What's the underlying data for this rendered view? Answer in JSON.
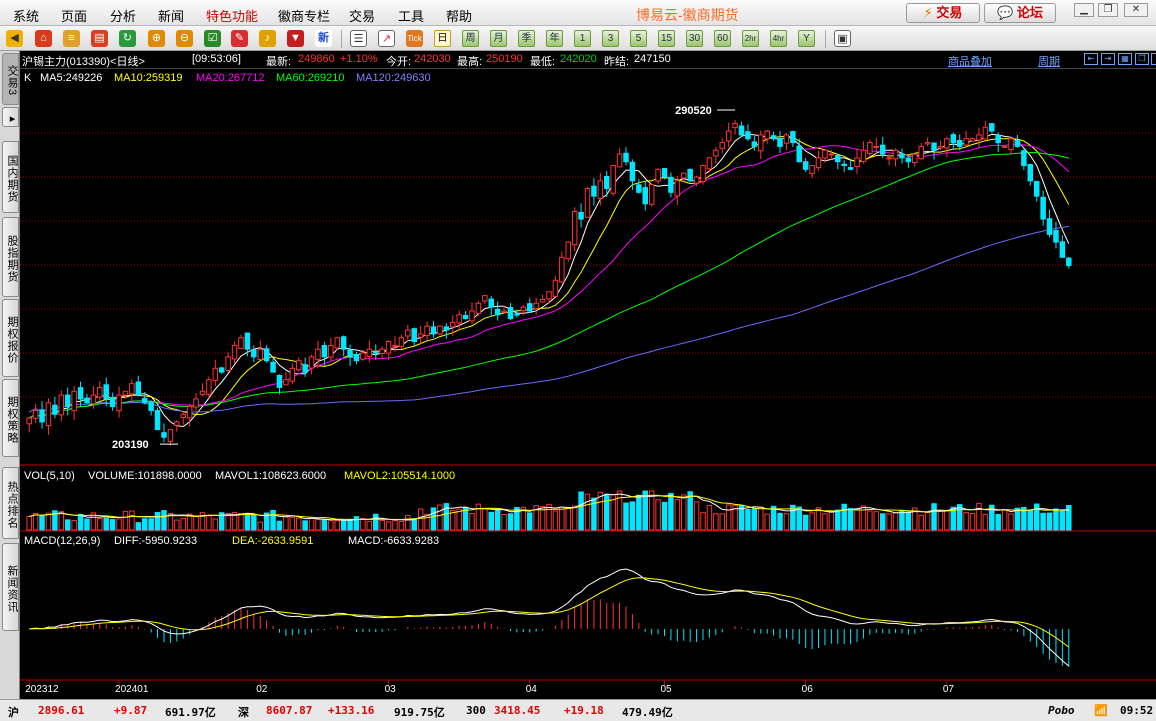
{
  "menu": {
    "items": [
      "系统",
      "页面",
      "分析",
      "新闻",
      "特色功能",
      "徽商专栏",
      "交易",
      "工具",
      "帮助"
    ],
    "special_index": 4,
    "app_title": "博易云-徽商期货",
    "trade_btn": "交易",
    "forum_btn": "论坛"
  },
  "toolbar": {
    "periods": [
      "日",
      "周",
      "月",
      "季",
      "年",
      "1",
      "3",
      "5",
      "15",
      "30",
      "60",
      "2hr",
      "4hr",
      "Y"
    ],
    "active_period": "日",
    "icons": [
      "back-icon",
      "home-icon",
      "database-icon",
      "news-icon",
      "refresh-icon",
      "zoom-in-icon",
      "zoom-out-icon",
      "checkbox-icon",
      "pen-icon",
      "bell-icon",
      "filter-icon",
      "new-icon",
      "list-icon",
      "chart-line-icon",
      "tick-icon"
    ],
    "tick_label": "Tick",
    "new_label": "新"
  },
  "infobar": {
    "contract": "沪锡主力(013390)<日线>",
    "time": "[09:53:06]",
    "latest_label": "最新:",
    "latest": "249860",
    "change": "+1.10%",
    "open_label": "今开:",
    "open": "242030",
    "high_label": "最高:",
    "high": "250190",
    "low_label": "最低:",
    "low": "242020",
    "prev_label": "昨结:",
    "prev": "247150",
    "overlay_link": "商品叠加",
    "period_link": "周期"
  },
  "left_tabs": [
    "交易",
    "国内期货",
    "股指期货",
    "期权报价",
    "期权策略",
    "热点排名",
    "新闻资讯"
  ],
  "left_tabs_badge": "3",
  "legend": {
    "k": "K",
    "ma5": "MA5:249226",
    "ma10": "MA10:259319",
    "ma20": "MA20:267712",
    "ma60": "MA60:269210",
    "ma120": "MA120:249630",
    "vol_name": "VOL(5,10)",
    "volume": "VOLUME:101898.0000",
    "mavol1": "MAVOL1:108623.6000",
    "mavol2": "MAVOL2:105514.1000",
    "macd_name": "MACD(12,26,9)",
    "diff": "DIFF:-5950.9233",
    "dea": "DEA:-2633.9591",
    "macd": "MACD:-6633.9283"
  },
  "annotations": {
    "high_mark": "290520",
    "low_mark": "203190"
  },
  "x_labels": [
    "202312",
    "202401",
    "02",
    "03",
    "04",
    "05",
    "06",
    "07"
  ],
  "colors": {
    "up": "#ff3232",
    "down": "#00e6ff",
    "ma5": "#ffffff",
    "ma10": "#ffff00",
    "ma20": "#ff00ff",
    "ma60": "#00ff00",
    "ma120": "#6b6bff"
  },
  "status": {
    "sh_label": "沪",
    "sh_index": "2896.61",
    "sh_change": "+9.87",
    "sh_amount": "691.97亿",
    "sz_label": "深",
    "sz_index": "8607.87",
    "sz_change": "+133.16",
    "sz_amount": "919.75亿",
    "hs300_label": "300",
    "hs300_index": "3418.45",
    "hs300_change": "+19.18",
    "hs300_amount": "479.49亿",
    "brand": "Pobo",
    "clock": "09:52"
  },
  "chart_data": {
    "type": "candlestick",
    "price_range": [
      198000,
      296000
    ],
    "closes": [
      210000,
      212000,
      209000,
      214000,
      211000,
      216000,
      213000,
      217000,
      215000,
      214000,
      216000,
      218000,
      215000,
      213000,
      216000,
      217000,
      219000,
      216000,
      214000,
      212000,
      207000,
      205000,
      207000,
      209000,
      211000,
      213000,
      215000,
      217000,
      220000,
      223000,
      222000,
      226000,
      229000,
      231000,
      228000,
      226000,
      228000,
      225000,
      222000,
      218000,
      220000,
      223000,
      225000,
      222000,
      226000,
      228000,
      226000,
      229000,
      231000,
      228000,
      226000,
      225000,
      227000,
      228000,
      227000,
      228000,
      230000,
      229000,
      231000,
      233000,
      230000,
      232000,
      234000,
      232000,
      234000,
      233000,
      235000,
      237000,
      236000,
      238000,
      240000,
      242000,
      239000,
      237000,
      238000,
      236000,
      237000,
      239000,
      238000,
      240000,
      241000,
      243000,
      246000,
      252000,
      256000,
      264000,
      262000,
      270000,
      268000,
      272000,
      270000,
      276000,
      279000,
      277000,
      272000,
      269000,
      266000,
      271000,
      275000,
      273000,
      269000,
      272000,
      274000,
      272000,
      273000,
      276000,
      278000,
      280000,
      282000,
      285000,
      287000,
      284000,
      283000,
      281000,
      284000,
      285000,
      283000,
      281000,
      284000,
      282000,
      277000,
      275000,
      276000,
      278000,
      280000,
      279000,
      277000,
      276000,
      275000,
      278000,
      280000,
      282000,
      281000,
      279000,
      278000,
      280000,
      278000,
      277000,
      279000,
      281000,
      282000,
      280000,
      281000,
      283000,
      282000,
      281000,
      283000,
      283000,
      284000,
      286000,
      285000,
      282000,
      281000,
      283000,
      281000,
      276000,
      272000,
      268000,
      262000,
      258000,
      256000,
      252000,
      249860
    ],
    "ma_series": [
      "ma5",
      "ma10",
      "ma20",
      "ma60",
      "ma120"
    ],
    "xlabel": "",
    "ylabel": ""
  }
}
